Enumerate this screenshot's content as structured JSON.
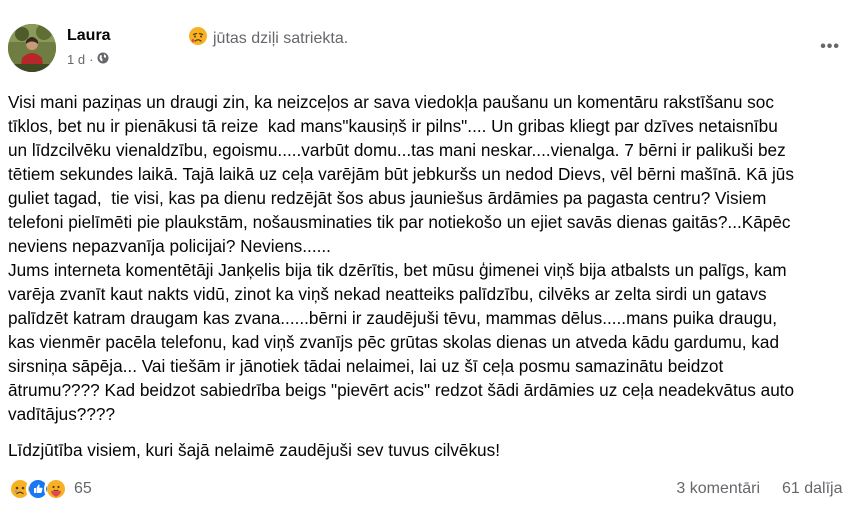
{
  "post": {
    "author": "Laura",
    "feeling": "jūtas dziļi satriekta.",
    "time": "1 d",
    "meta_separator": "·",
    "more_label": "•••",
    "body_lines": [
      "Visi mani paziņas un draugi zin, ka neizceļos ar sava viedokļa paušanu un komentāru rakstīšanu soc",
      "tīklos, bet nu ir pienākusi tā reize  kad mans\"kausiņš ir pilns\".... Un gribas kliegt par dzīves netaisnību",
      "un līdzcilvēku vienaldzību, egoismu.....varbūt domu...tas mani neskar....vienalga. 7 bērni ir palikuši bez",
      "tētiem sekundes laikā. Tajā laikā uz ceļa varējām būt jebkuršs un nedod Dievs, vēl bērni mašīnā. Kā jūs",
      "guliet tagad,  tie visi, kas pa dienu redzējāt šos abus jauniešus ārdāmies pa pagasta centru? Visiem",
      "telefoni pielīmēti pie plaukstām, nošausminaties tik par notiekošo un ejiet savās dienas gaitās?...Kāpēc",
      "neviens nepazvanīja policijai? Neviens......",
      "Jums interneta komentētāji Janķelis bija tik dzērītis, bet mūsu ģimenei viņš bija atbalsts un palīgs, kam",
      "varēja zvanīt kaut nakts vidū, zinot ka viņš nekad neatteiks palīdzību, cilvēks ar zelta sirdi un gatavs",
      "palīdzēt katram draugam kas zvana......bērni ir zaudējuši tēvu, mammas dēlus.....mans puika draugu,",
      "kas vienmēr pacēla telefonu, kad viņš zvanījs pēc grūtas skolas dienas un atveda kādu gardumu, kad",
      "sirsniņa sāpēja... Vai tiešām ir jānotiek tādai nelaimei, lai uz šī ceļa posmu samazinātu beidzot",
      "ātrumu???? Kad beidzot sabiedrība beigs \"pievērt acis\" redzot šādi ārdāmies uz ceļa neadekvātus auto",
      "vadītājus????",
      "",
      "Līdzjūtība visiem, kuri šajā nelaimē zaudējuši sev tuvus cilvēkus!"
    ]
  },
  "footer": {
    "reaction_count": "65",
    "comments": "3 komentāri",
    "shares": "61 dalīja"
  },
  "colors": {
    "secondary_text": "#65676b",
    "like_blue": "#1877f2",
    "sad_yellow": "#f7b125"
  },
  "icons": [
    "sad-reaction-icon",
    "like-reaction-icon",
    "care-reaction-icon",
    "globe-icon",
    "more-options-icon",
    "feeling-icon"
  ]
}
